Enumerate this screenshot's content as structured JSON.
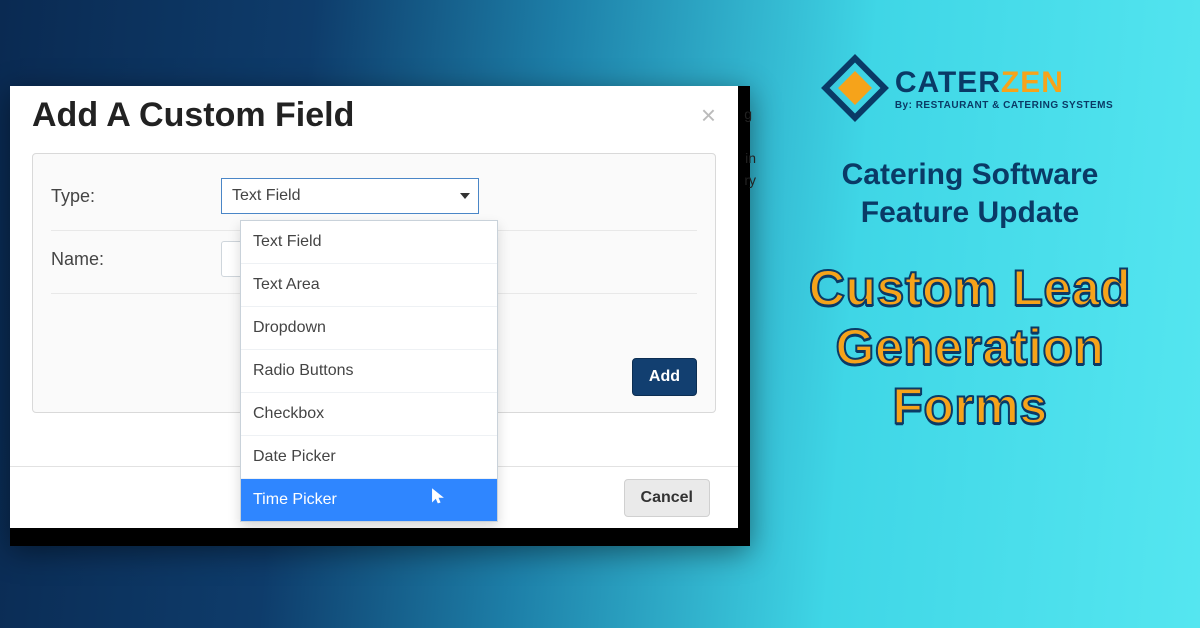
{
  "brand": {
    "name_a": "CATER",
    "name_b": "ZEN",
    "tagline": "By: RESTAURANT & CATERING SYSTEMS"
  },
  "promo": {
    "subhead_line1": "Catering Software",
    "subhead_line2": "Feature Update",
    "headline_line1": "Custom Lead",
    "headline_line2": "Generation",
    "headline_line3": "Forms"
  },
  "modal": {
    "title": "Add A Custom Field",
    "type_label": "Type:",
    "name_label": "Name:",
    "selected_type": "Text Field",
    "add_label": "Add",
    "cancel_label": "Cancel",
    "options": [
      "Text Field",
      "Text Area",
      "Dropdown",
      "Radio Buttons",
      "Checkbox",
      "Date Picker",
      "Time Picker"
    ],
    "hovered_index": 6
  },
  "bgfrag": {
    "a": "g",
    "b": "in",
    "c": "ry"
  }
}
